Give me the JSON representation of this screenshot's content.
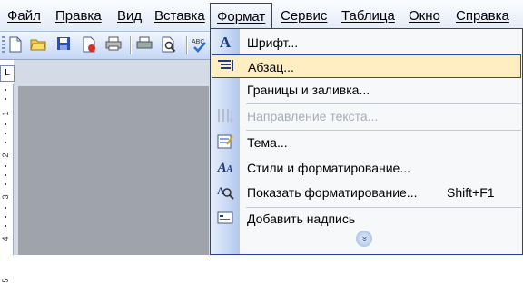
{
  "menubar": {
    "items": [
      {
        "label": "Файл"
      },
      {
        "label": "Правка"
      },
      {
        "label": "Вид"
      },
      {
        "label": "Вставка"
      },
      {
        "label": "Формат",
        "active": true
      },
      {
        "label": "Сервис"
      },
      {
        "label": "Таблица"
      },
      {
        "label": "Окно"
      },
      {
        "label": "Справка"
      }
    ]
  },
  "toolbar": {
    "icons": [
      "new-document-icon",
      "open-folder-icon",
      "save-icon",
      "permission-icon",
      "print-icon",
      "quick-print-icon",
      "print-preview-icon",
      "spelling-icon"
    ]
  },
  "ruler": {
    "corner": "L",
    "numbers": [
      "1",
      "2",
      "3",
      "4",
      "5"
    ]
  },
  "format_menu": {
    "items": [
      {
        "icon": "font-icon",
        "label": "Шрифт..."
      },
      {
        "icon": "paragraph-icon",
        "label": "Абзац...",
        "highlighted": true
      },
      {
        "icon": "",
        "label": "Границы и заливка..."
      },
      {
        "icon": "text-direction-icon",
        "label": "Направление текста...",
        "disabled": true
      },
      {
        "icon": "theme-icon",
        "label": "Тема..."
      },
      {
        "icon": "styles-icon",
        "label": "Стили и форматирование..."
      },
      {
        "icon": "reveal-formatting-icon",
        "label": "Показать форматирование...",
        "shortcut": "Shift+F1"
      },
      {
        "icon": "text-box-icon",
        "label": "Добавить надпись"
      }
    ],
    "expand_icon": "double-chevron-down-icon"
  },
  "colors": {
    "menu_highlight": "#ffeec2",
    "menu_border": "#29419a",
    "disabled_text": "#a7adb8"
  }
}
